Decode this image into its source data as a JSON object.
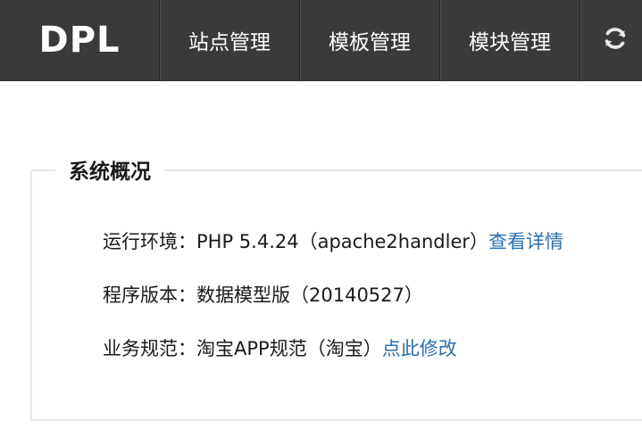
{
  "header": {
    "logo": "DPL",
    "nav": [
      {
        "label": "站点管理"
      },
      {
        "label": "模板管理"
      },
      {
        "label": "模块管理"
      }
    ],
    "refresh_icon": "refresh-icon"
  },
  "panel": {
    "title": "系统概况",
    "rows": [
      {
        "label": "运行环境：",
        "value": "PHP 5.4.24（apache2handler）",
        "link": "查看详情"
      },
      {
        "label": "程序版本：",
        "value": "数据模型版（20140527）",
        "link": ""
      },
      {
        "label": "业务规范：",
        "value": "淘宝APP规范（淘宝）",
        "link": "点此修改"
      }
    ]
  },
  "colors": {
    "topbar": "#3a3a3a",
    "link": "#2a6fb0",
    "panel_border": "#e6e9ee"
  }
}
